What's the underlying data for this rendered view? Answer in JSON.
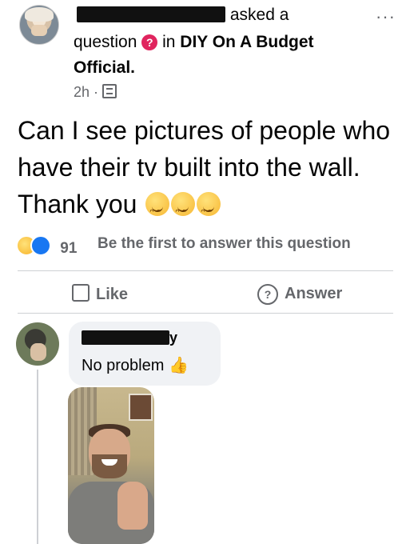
{
  "post": {
    "header_suffix": "asked a",
    "header_mid": "question",
    "header_in": "in",
    "group_name": "DIY On A Budget",
    "group_name_2": "Official.",
    "time": "2h ·",
    "more_label": "···",
    "text": "Can I see pictures of people who have their tv built into the wall. Thank you",
    "question_icon": "question-mark-icon",
    "privacy_icon": "group-privacy-icon"
  },
  "reactions": {
    "count": "91",
    "icons": [
      "haha-reaction-icon",
      "like-reaction-icon"
    ]
  },
  "first_answer": "Be the first to answer this question",
  "actions": {
    "like": "Like",
    "answer": "Answer"
  },
  "comment": {
    "text": "No problem",
    "name_fragment": "y"
  },
  "colors": {
    "question_badge": "#e0245e",
    "like_blue": "#1877f2",
    "muted": "#65676b"
  }
}
